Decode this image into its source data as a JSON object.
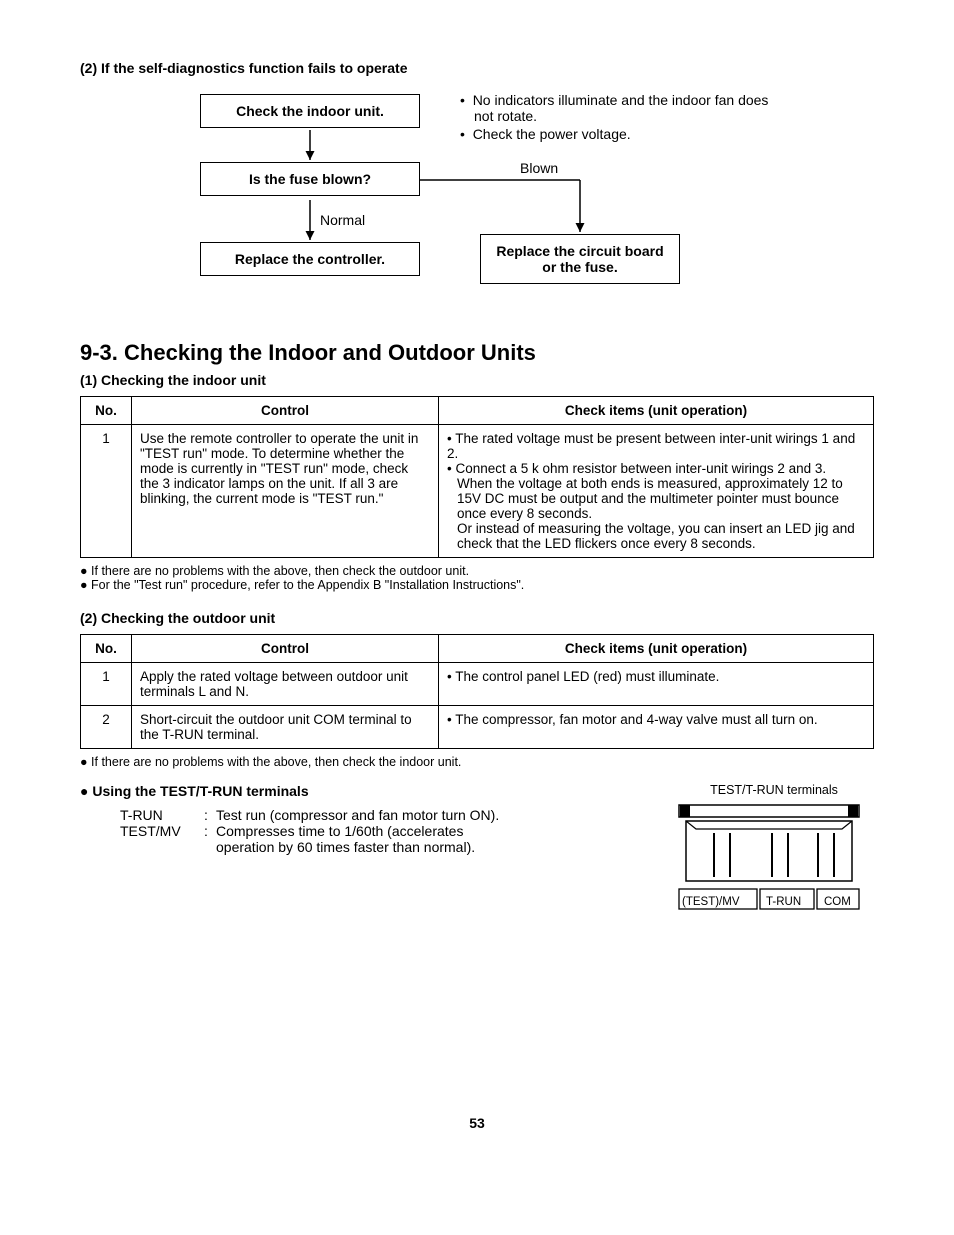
{
  "header2": "(2) If the self-diagnostics function fails to operate",
  "flow": {
    "box1": "Check the indoor unit.",
    "box2": "Is the fuse blown?",
    "box3": "Replace the controller.",
    "box4": "Replace the circuit board or the fuse.",
    "labelBlown": "Blown",
    "labelNormal": "Normal",
    "side1": "No indicators illuminate and the indoor fan does not rotate.",
    "side2": "Check the power voltage."
  },
  "bigHeading": "9-3. Checking the Indoor and Outdoor Units",
  "sub1": "(1) Checking the indoor unit",
  "table1": {
    "h1": "No.",
    "h2": "Control",
    "h3": "Check items (unit operation)",
    "r1n": "1",
    "r1c": "Use the remote controller to operate the unit in \"TEST run\" mode. To determine whether the mode is currently in \"TEST run\" mode, check the 3 indicator lamps on the unit. If all 3 are blinking, the current mode is \"TEST run.\"",
    "r1k_a": "• The rated voltage must be present between inter-unit wirings 1 and 2.",
    "r1k_b": "• Connect a 5 k ohm resistor between inter-unit wirings 2 and 3. When the voltage at both ends is measured, approximately 12 to 15V DC must be output and the multimeter pointer must bounce once every 8 seconds.",
    "r1k_c": "Or instead of measuring the voltage, you can insert an LED jig and check that the LED flickers once every 8 seconds."
  },
  "notes1a": "If there are no problems with the above, then check the outdoor unit.",
  "notes1b": "For the \"Test run\" procedure, refer to the Appendix B \"Installation Instructions\".",
  "sub2": "(2) Checking the outdoor unit",
  "table2": {
    "h1": "No.",
    "h2": "Control",
    "h3": "Check items (unit operation)",
    "r1n": "1",
    "r1c": "Apply the rated voltage between outdoor unit terminals L and N.",
    "r1k": "• The control panel LED (red) must illuminate.",
    "r2n": "2",
    "r2c": "Short-circuit the outdoor unit COM terminal to the T-RUN terminal.",
    "r2k": "• The compressor, fan motor and 4-way valve must all turn on."
  },
  "notes2": "If there are no problems with the above, then check the indoor unit.",
  "termsHeading": "Using the TEST/T-RUN terminals",
  "terms": {
    "t1l": "T-RUN",
    "t1d": "Test run (compressor and fan motor turn ON).",
    "t2l": "TEST/MV",
    "t2d1": "Compresses time to 1/60th (accelerates",
    "t2d2": "operation by 60 times faster than normal)."
  },
  "terminalsCaption": "TEST/T-RUN terminals",
  "termLabels": {
    "a": "(TEST)/MV",
    "b": "T-RUN",
    "c": "COM"
  },
  "pageNum": "53"
}
